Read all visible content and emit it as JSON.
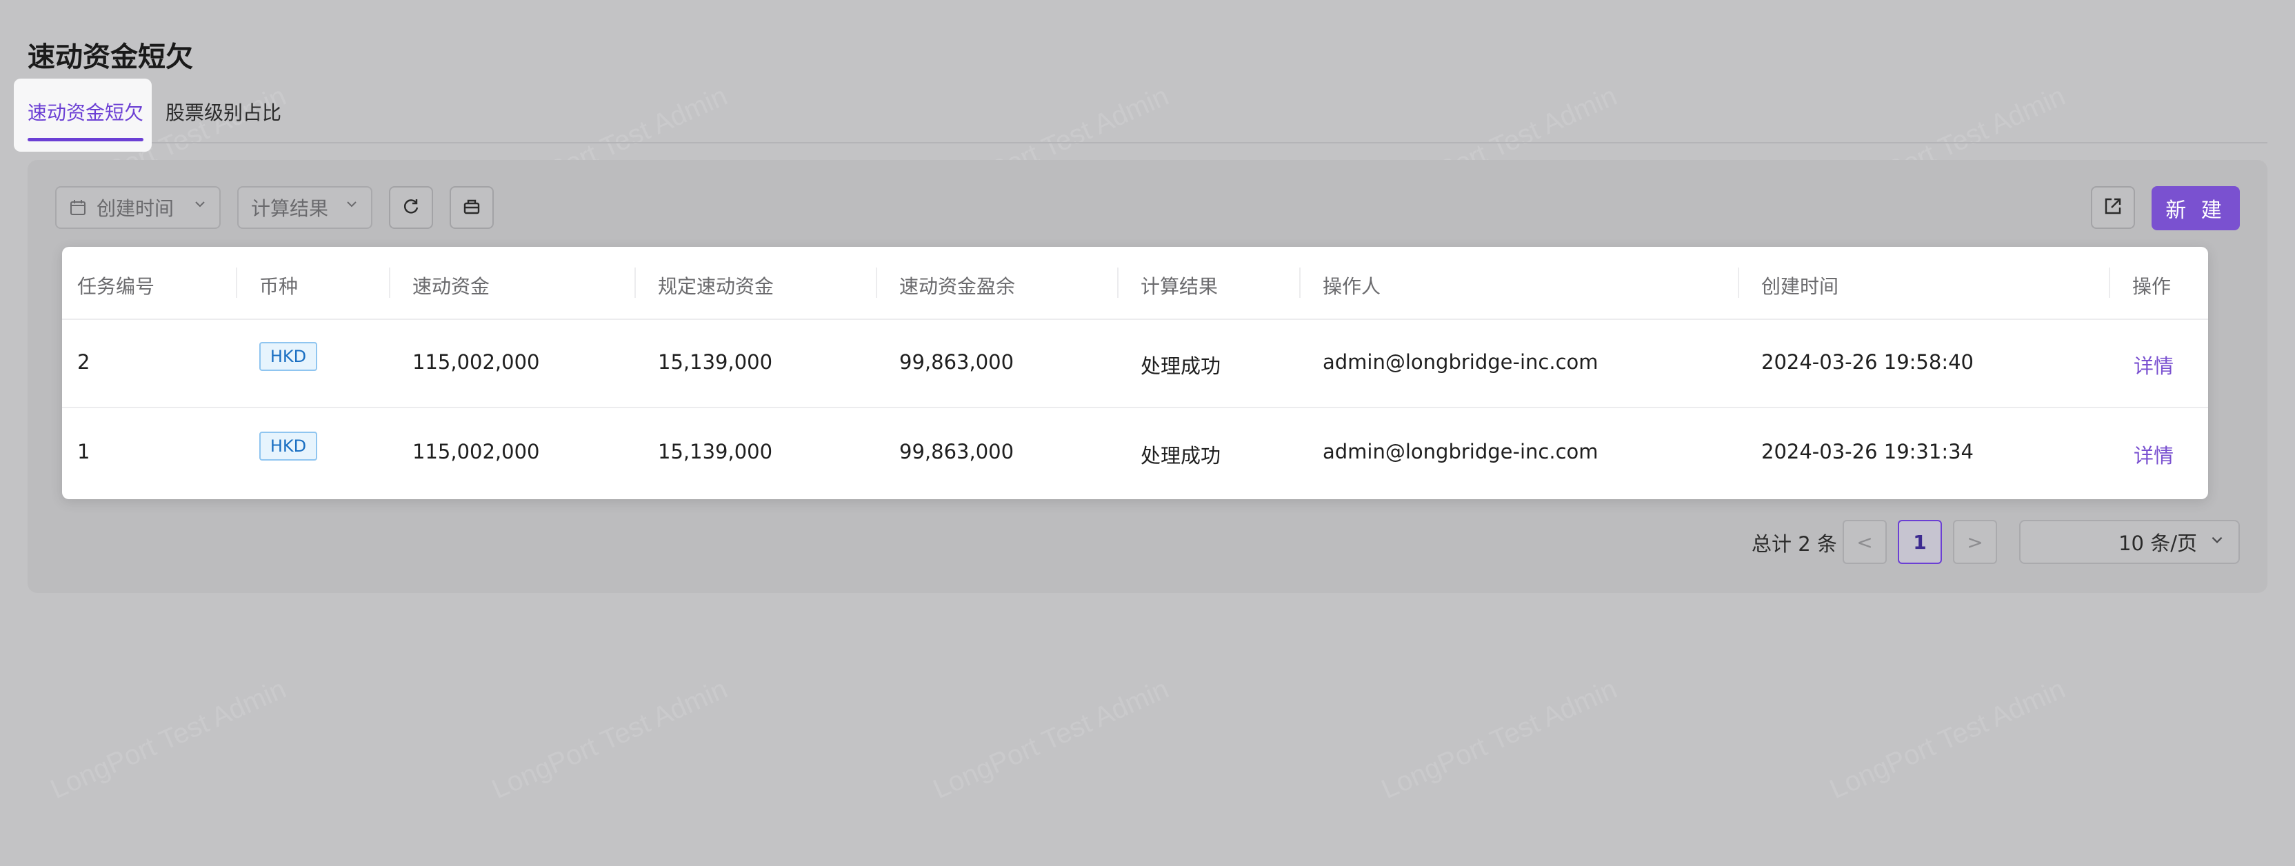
{
  "page": {
    "title": "速动资金短欠"
  },
  "tabs": [
    {
      "label": "速动资金短欠",
      "active": true
    },
    {
      "label": "股票级别占比",
      "active": false
    }
  ],
  "toolbar": {
    "created_time_placeholder": "创建时间",
    "calc_result_placeholder": "计算结果",
    "refresh_icon": "refresh-icon",
    "clear_icon": "clear-basket-icon",
    "export_icon": "export-icon",
    "new_label": "新 建"
  },
  "table": {
    "columns": [
      "任务编号",
      "币种",
      "速动资金",
      "规定速动资金",
      "速动资金盈余",
      "计算结果",
      "操作人",
      "创建时间",
      "操作"
    ],
    "rows": [
      {
        "id": "2",
        "currency": "HKD",
        "quick_funds": "115,002,000",
        "required_quick_funds": "15,139,000",
        "surplus": "99,863,000",
        "result": "处理成功",
        "operator": "admin@longbridge-inc.com",
        "created_at": "2024-03-26 19:58:40",
        "action": "详情"
      },
      {
        "id": "1",
        "currency": "HKD",
        "quick_funds": "115,002,000",
        "required_quick_funds": "15,139,000",
        "surplus": "99,863,000",
        "result": "处理成功",
        "operator": "admin@longbridge-inc.com",
        "created_at": "2024-03-26 19:31:34",
        "action": "详情"
      }
    ]
  },
  "pagination": {
    "total_text": "总计 2 条",
    "prev": "<",
    "current_page": "1",
    "next": ">",
    "page_size": "10 条/页"
  },
  "watermark": "LongPort Test Admin",
  "colors": {
    "accent": "#6b3fd4",
    "primary_button": "#7a51d0",
    "tag_border": "#8fc5f0",
    "tag_text": "#1a6fc2"
  }
}
